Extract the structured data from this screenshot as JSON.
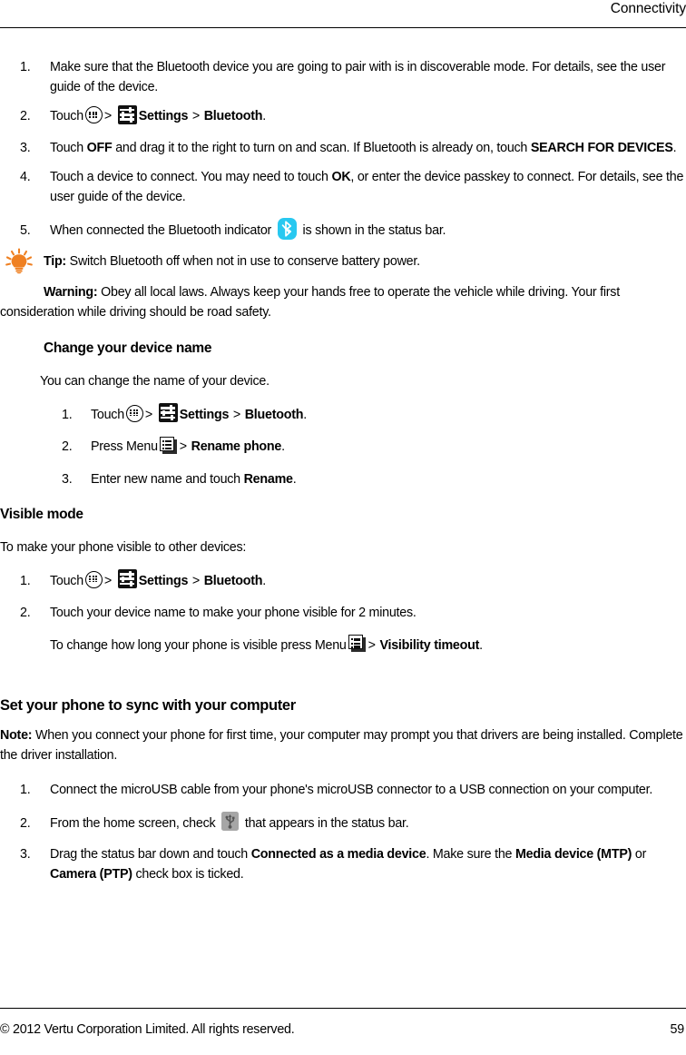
{
  "header": {
    "title": "Connectivity"
  },
  "footer": {
    "copyright": "© 2012 Vertu Corporation Limited. All rights reserved.",
    "page_number": "59"
  },
  "colors": {
    "bluetooth_badge": "#28c8f0",
    "usb_badge": "#a6a6a6",
    "tip_bulb": "#ef8022",
    "settings_tile": "#111111",
    "text": "#000000",
    "page_background": "#ffffff"
  },
  "pairing_steps": {
    "items": [
      {
        "num": "1.",
        "text": "Make sure that the Bluetooth device you are going to pair with is in discoverable mode. For details, see the user guide of the device."
      },
      {
        "num": "2.",
        "touch_label": "Touch",
        "sep1": ">",
        "settings_label": "Settings",
        "sep2": ">",
        "bluetooth_label": "Bluetooth",
        "period": "."
      },
      {
        "num": "3.",
        "pre": "Touch ",
        "off_label": "OFF",
        "mid": " and drag it to the right to turn on and scan. If Bluetooth is already on, touch ",
        "search_label": "SEARCH FOR DEVICES",
        "post": "."
      },
      {
        "num": "4.",
        "pre": "Touch a device to connect. You may need to touch ",
        "ok_label": "OK",
        "post": ", or enter the device passkey to connect. For details, see the user guide of the device."
      },
      {
        "num": "5.",
        "pre": "When connected the Bluetooth indicator",
        "post": "is shown in the status bar."
      }
    ]
  },
  "tip": {
    "label": "Tip:",
    "text": " Switch Bluetooth off when not in use to conserve battery power.",
    "icon": "lightbulb-icon"
  },
  "warning": {
    "label": "Warning:",
    "text": " Obey all local laws. Always keep your hands free to operate the vehicle while driving. Your first consideration while driving should be road safety."
  },
  "change_device_name": {
    "heading": "Change your device name",
    "intro": "You can change the name of your device.",
    "items": [
      {
        "num": "1.",
        "touch_label": "Touch",
        "sep1": ">",
        "settings_label": "Settings",
        "sep2": ">",
        "bluetooth_label": "Bluetooth",
        "period": "."
      },
      {
        "num": "2.",
        "press_label": "Press Menu",
        "sep": ">",
        "action_label": "Rename phone",
        "period": "."
      },
      {
        "num": "3.",
        "pre": "Enter new name and touch ",
        "action_label": "Rename",
        "post": "."
      }
    ]
  },
  "visible_mode": {
    "heading": "Visible mode",
    "intro": "To make your phone visible to other devices:",
    "items": [
      {
        "num": "1.",
        "touch_label": "Touch",
        "sep1": ">",
        "settings_label": "Settings",
        "sep2": ">",
        "bluetooth_label": "Bluetooth",
        "period": "."
      },
      {
        "num": "2.",
        "text": "Touch your device name to make your phone visible for 2 minutes."
      }
    ],
    "note": {
      "pre": "To change how long your phone is visible press Menu",
      "sep": ">",
      "action_label": "Visibility timeout",
      "post": "."
    }
  },
  "sync_section": {
    "heading": "Set your phone to sync with your computer",
    "note_label": "Note:",
    "note_text": " When you connect your phone for first time, your computer may prompt you that drivers are being installed. Complete the driver installation.",
    "items": [
      {
        "num": "1.",
        "text": "Connect the microUSB cable from your phone's microUSB connector to a USB connection on your computer."
      },
      {
        "num": "2.",
        "pre": "From the home screen, check",
        "post": "that appears in the status bar."
      },
      {
        "num": "3.",
        "pre": "Drag the status bar down and touch ",
        "bold1": "Connected as a media device",
        "mid1": ". Make sure the ",
        "bold2": "Media device (MTP)",
        "mid2": " or ",
        "bold3": "Camera (PTP)",
        "post": " check box is ticked."
      }
    ]
  }
}
